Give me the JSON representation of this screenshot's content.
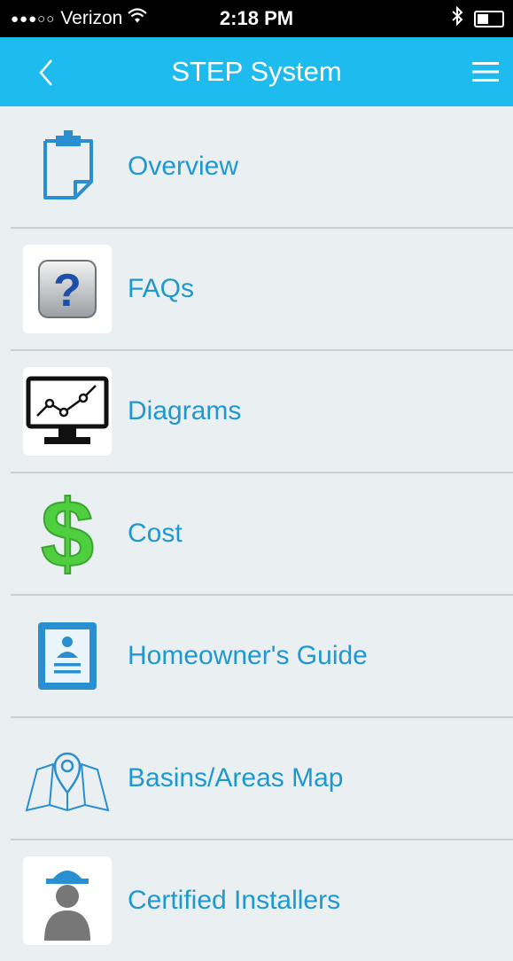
{
  "status": {
    "carrier": "Verizon",
    "time": "2:18 PM"
  },
  "header": {
    "title": "STEP System"
  },
  "menu": {
    "items": [
      {
        "label": "Overview",
        "icon": "clipboard-icon"
      },
      {
        "label": "FAQs",
        "icon": "question-icon"
      },
      {
        "label": "Diagrams",
        "icon": "monitor-chart-icon"
      },
      {
        "label": "Cost",
        "icon": "dollar-icon"
      },
      {
        "label": "Homeowner's Guide",
        "icon": "guide-card-icon"
      },
      {
        "label": "Basins/Areas Map",
        "icon": "map-pin-icon"
      },
      {
        "label": "Certified Installers",
        "icon": "installer-hardhat-icon"
      }
    ]
  },
  "colors": {
    "nav": "#1dbbee",
    "label": "#1f98cf",
    "background": "#eaeff2",
    "dollar": "#4fcf3f"
  }
}
